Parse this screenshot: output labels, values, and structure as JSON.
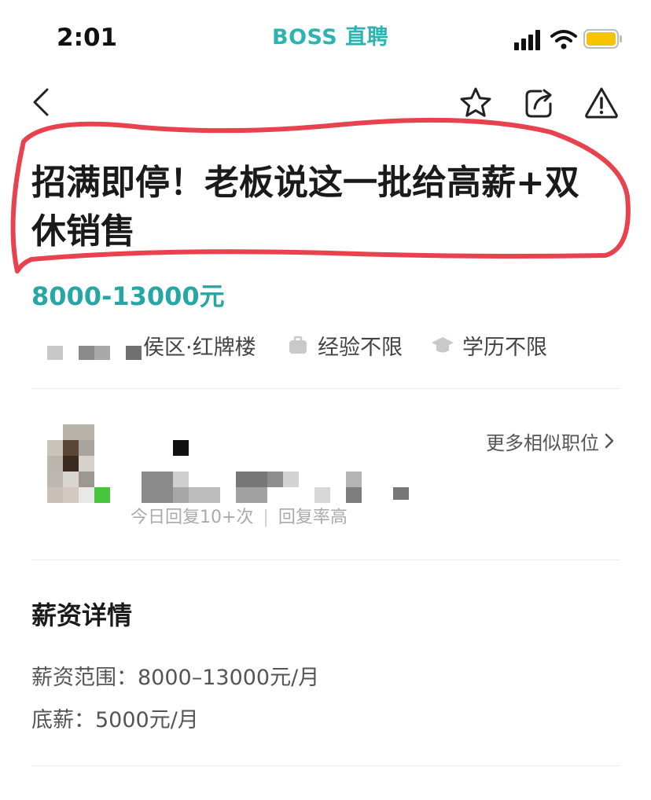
{
  "status_bar": {
    "time": "2:01",
    "app_name": "BOSS 直聘",
    "brand_color": "#2bb5b0"
  },
  "nav": {
    "back_icon": "chevron-left-icon",
    "actions": [
      "star-icon",
      "share-icon",
      "report-warning-icon"
    ]
  },
  "job": {
    "title": "招满即停！老板说这一批给高薪+双休销售",
    "salary": "8000-13000元",
    "salary_color": "#27a7a3",
    "tags": {
      "location": "侯区·红牌楼",
      "experience": "经验不限",
      "education": "学历不限"
    }
  },
  "recruiter": {
    "more_jobs_label": "更多相似职位",
    "reply_stat": "今日回复10+次",
    "reply_rate": "回复率高"
  },
  "salary_details": {
    "heading": "薪资详情",
    "range_label": "薪资范围：",
    "range_value": "8000–13000元/月",
    "base_label": "底薪：",
    "base_value": "5000元/月"
  },
  "annotation": {
    "highlight_color": "#e8424f"
  }
}
